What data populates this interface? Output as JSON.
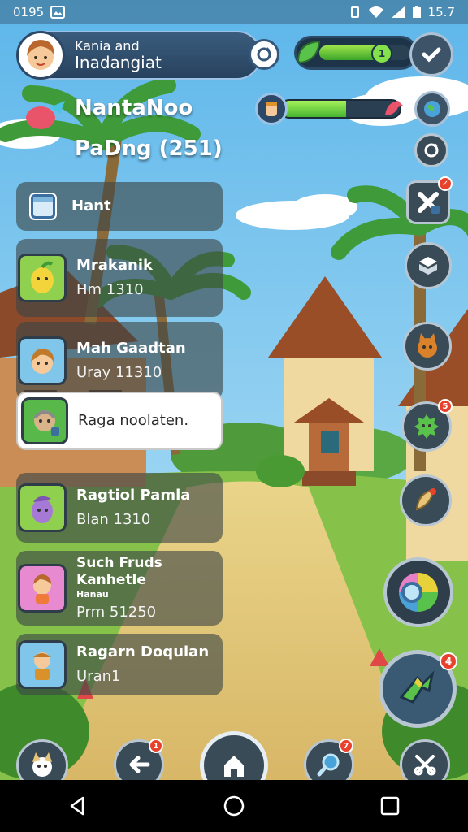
{
  "status_bar": {
    "time": "0195",
    "battery": "15.7"
  },
  "player": {
    "name_line1": "Kania and",
    "name_line2": "Inadangiat"
  },
  "hud": {
    "top_badge": "1",
    "top_progress": 0.62,
    "xp_progress": 0.55
  },
  "title": {
    "main": "NantaNoo",
    "subtitle": "PaDng (251)"
  },
  "quests": [
    {
      "title": "Hant",
      "sub": ""
    },
    {
      "title": "Mrakanik",
      "sub": "Hm 1310"
    },
    {
      "title": "Mah Gaadtan",
      "sub": "Uray 11310"
    },
    {
      "title": "Raga noolaten.",
      "sub": ""
    },
    {
      "title": "Ragtiol Pamla",
      "sub": "Blan 1310"
    },
    {
      "title": "Such Fruds Kanhetle",
      "caption": "Hanau",
      "sub": "Prm 51250"
    },
    {
      "title": "Ragarn Doquian",
      "sub": "Uran1"
    }
  ],
  "notifications": {
    "bag": "5",
    "joystick": "4",
    "back": "1",
    "search": "7"
  },
  "colors": {
    "panel": "#3b5c7d",
    "accent_green": "#46b430",
    "badge_red": "#e8412c"
  }
}
